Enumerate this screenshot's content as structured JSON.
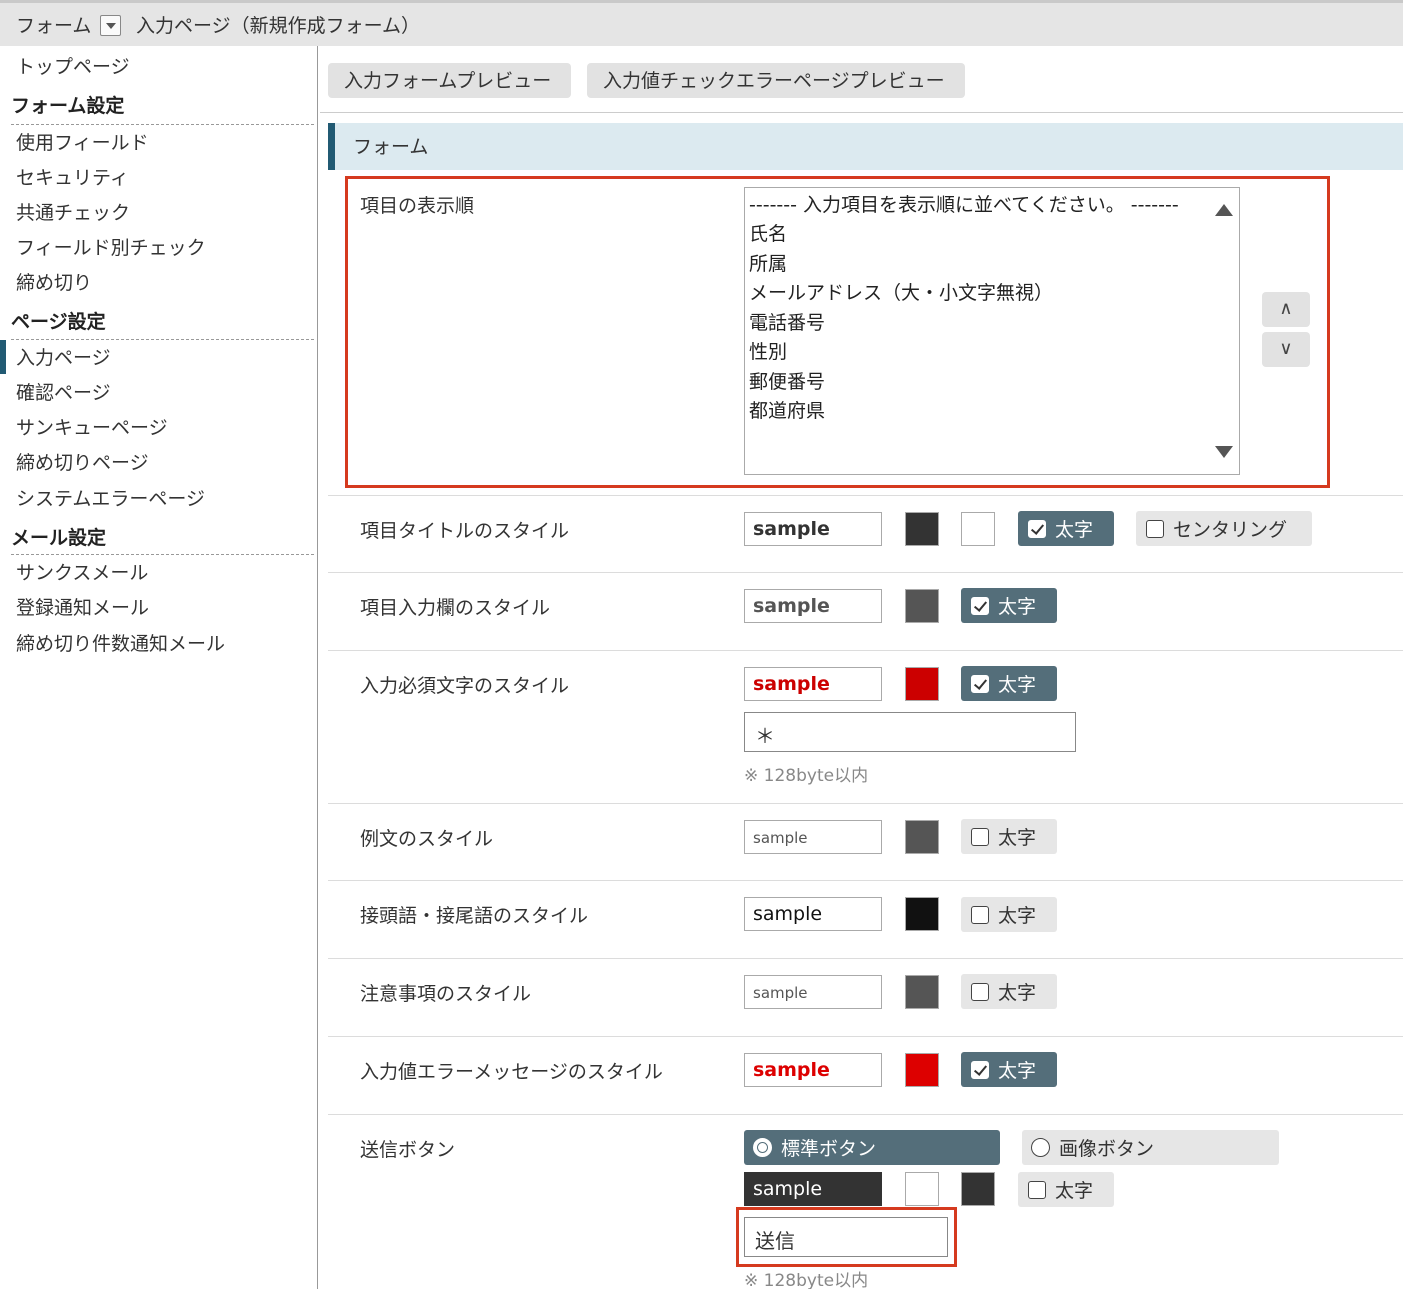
{
  "breadcrumb": {
    "form": "フォーム",
    "page": "入力ページ（新規作成フォーム）",
    "dropdown_icon": "chevron-down-icon"
  },
  "sidebar": {
    "top": "トップページ",
    "form_settings": {
      "heading": "フォーム設定",
      "items": [
        "使用フィールド",
        "セキュリティ",
        "共通チェック",
        "フィールド別チェック",
        "締め切り"
      ]
    },
    "page_settings": {
      "heading": "ページ設定",
      "items": [
        "入力ページ",
        "確認ページ",
        "サンキューページ",
        "締め切りページ",
        "システムエラーページ"
      ],
      "active": "入力ページ"
    },
    "mail_settings": {
      "heading": "メール設定",
      "items": [
        "サンクスメール",
        "登録通知メール",
        "締め切り件数通知メール"
      ]
    }
  },
  "preview_buttons": [
    "入力フォームプレビュー",
    "入力値チェックエラーページプレビュー"
  ],
  "section_title": "フォーム",
  "order": {
    "label": "項目の表示順",
    "options": [
      "------- 入力項目を表示順に並べてください。 -------",
      "氏名",
      "所属",
      "メールアドレス（大・小文字無視）",
      "電話番号",
      "性別",
      "郵便番号",
      "都道府県"
    ],
    "up_label": "∧",
    "down_label": "∨"
  },
  "styles": {
    "item_title": {
      "label": "項目タイトルのスタイル",
      "sample": "sample",
      "text_color": "#333333",
      "bg_color": "#ffffff",
      "bold_label": "太字",
      "bold": true,
      "center_label": "センタリング",
      "center": false
    },
    "item_input": {
      "label": "項目入力欄のスタイル",
      "sample": "sample",
      "color": "#555555",
      "bold_label": "太字",
      "bold": true
    },
    "required": {
      "label": "入力必須文字のスタイル",
      "sample": "sample",
      "color": "#cc0000",
      "bold_label": "太字",
      "bold": true,
      "mark": "＊",
      "note": "※ 128byte以内"
    },
    "example": {
      "label": "例文のスタイル",
      "sample": "sample",
      "color": "#555555",
      "bold_label": "太字",
      "bold": false
    },
    "affix": {
      "label": "接頭語・接尾語のスタイル",
      "sample": "sample",
      "color": "#111111",
      "bold_label": "太字",
      "bold": false
    },
    "caution": {
      "label": "注意事項のスタイル",
      "sample": "sample",
      "color": "#555555",
      "bold_label": "太字",
      "bold": false
    },
    "error_msg": {
      "label": "入力値エラーメッセージのスタイル",
      "sample": "sample",
      "color": "#dd0000",
      "bold_label": "太字",
      "bold": true
    }
  },
  "submit": {
    "label": "送信ボタン",
    "standard_label": "標準ボタン",
    "image_label": "画像ボタン",
    "selected": "標準ボタン",
    "sample": "sample",
    "text_color": "#ffffff",
    "bg_color": "#333333",
    "bold_label": "太字",
    "bold": false,
    "button_text": "送信",
    "note": "※ 128byte以内"
  }
}
